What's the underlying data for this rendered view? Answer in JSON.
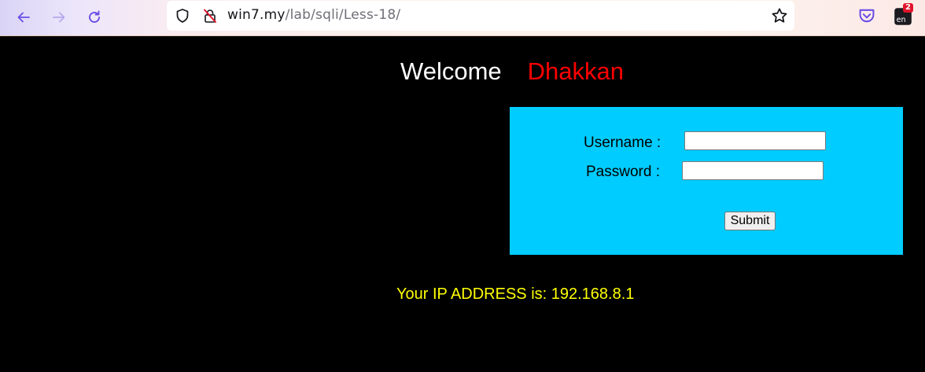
{
  "browser": {
    "url_host": "win7.my",
    "url_path": "/lab/sqli/Less-18/",
    "extension_badge": "2",
    "icons": {
      "back": "back-arrow-icon",
      "forward": "forward-arrow-icon",
      "reload": "reload-icon",
      "tracking": "shield-icon",
      "insecure": "insecure-lock-icon",
      "bookmark": "star-icon",
      "pocket": "pocket-icon",
      "extension": "extension-icon"
    }
  },
  "page": {
    "welcome_word": "Welcome",
    "welcome_name": "Dhakkan",
    "form": {
      "username_label": "Username :",
      "username_value": "",
      "password_label": "Password :",
      "password_value": "",
      "submit_label": "Submit"
    },
    "ip_text": "Your IP ADDRESS is: 192.168.8.1"
  },
  "colors": {
    "background": "#000000",
    "welcome_word": "#ffffff",
    "welcome_name": "#ff0000",
    "form_background": "#00ccff",
    "ip_text": "#ffff00"
  }
}
